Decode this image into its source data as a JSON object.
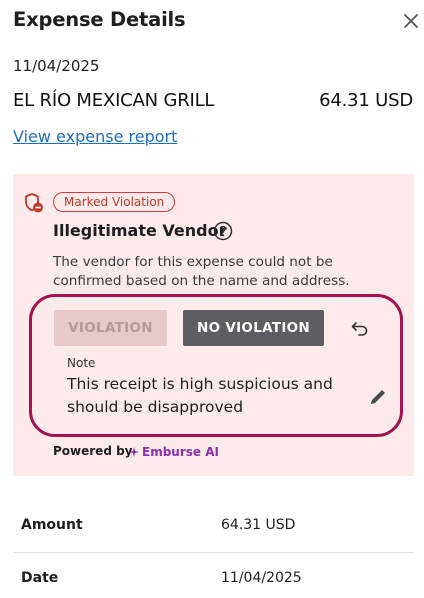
{
  "header": {
    "title": "Expense Details",
    "close_icon": "close-icon"
  },
  "expense": {
    "date": "11/04/2025",
    "vendor": "EL RÍO MEXICAN GRILL",
    "amount": "64.31 USD",
    "report_link": "View expense report"
  },
  "violation": {
    "badge": "Marked Violation",
    "title": "Illegitimate Vendor",
    "description": "The vendor for this expense could not be confirmed based on the name and address.",
    "violation_button": "VIOLATION",
    "no_violation_button": "NO VIOLATION",
    "note_label": "Note",
    "note_text": "This receipt is high suspicious and should be disapproved",
    "powered_by": "Powered by",
    "ai_brand": "Emburse AI",
    "colors": {
      "panel_bg": "#fdeaea",
      "highlight": "#a4114f",
      "badge": "#d63c3c",
      "ai_brand": "#8a2fb0"
    }
  },
  "details": {
    "rows": [
      {
        "label": "Amount",
        "value": "64.31 USD"
      },
      {
        "label": "Date",
        "value": "11/04/2025"
      }
    ]
  }
}
